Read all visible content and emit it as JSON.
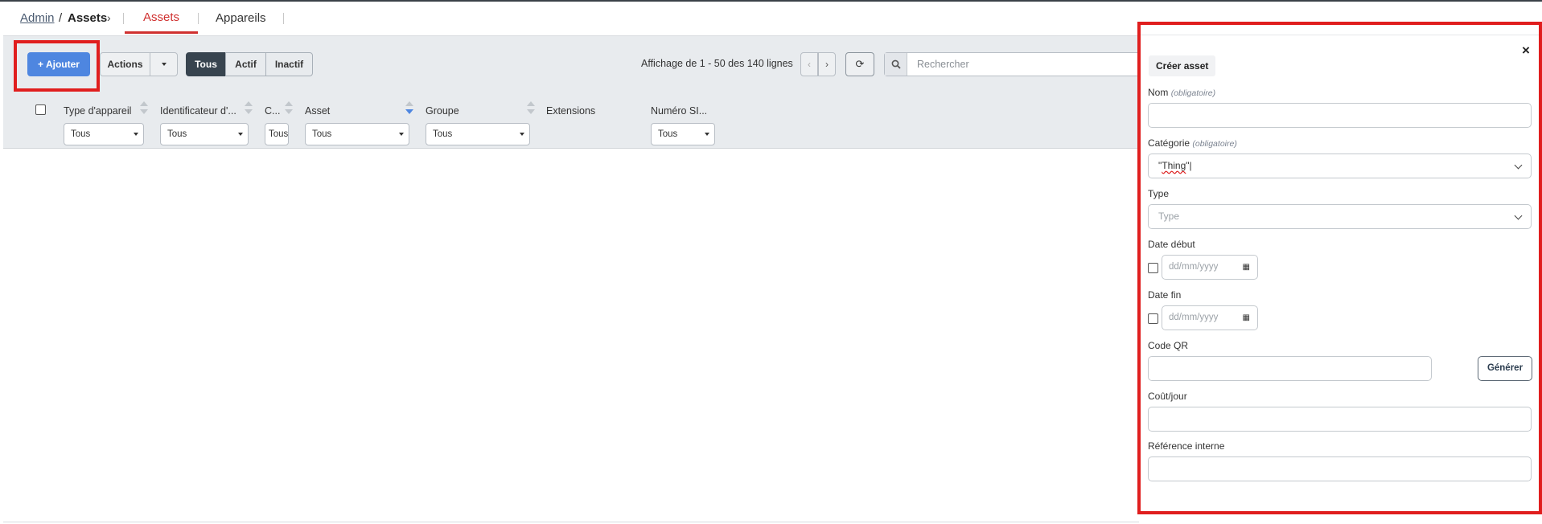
{
  "breadcrumb": {
    "admin": "Admin",
    "separator": "/",
    "current": "Assets",
    "chevron": "›"
  },
  "tabs": [
    {
      "label": "Assets",
      "active": true
    },
    {
      "label": "Appareils",
      "active": false
    }
  ],
  "toolbar": {
    "add_label": "+ Ajouter",
    "actions_label": "Actions",
    "filters": [
      "Tous",
      "Actif",
      "Inactif"
    ],
    "pagination_text": "Affichage de 1 - 50 des 140 lignes",
    "prev_icon": "‹",
    "next_icon": "›",
    "refresh_icon": "⟳",
    "search_icon": "⚲",
    "search_placeholder": "Rechercher"
  },
  "columns": [
    {
      "label": "Type d'appareil",
      "filter": "Tous"
    },
    {
      "label": "Identificateur d'...",
      "filter": "Tous"
    },
    {
      "label": "C...",
      "filter": "Tous"
    },
    {
      "label": "Asset",
      "filter": "Tous"
    },
    {
      "label": "Groupe",
      "filter": "Tous"
    },
    {
      "label": "Extensions",
      "filter": ""
    },
    {
      "label": "Numéro SI...",
      "filter": "Tous"
    }
  ],
  "panel": {
    "close_icon": "×",
    "title": "Créer asset",
    "name_label": "Nom",
    "required_text": "(obligatoire)",
    "category_label": "Catégorie",
    "category_value_pre": "\"",
    "category_value_word": "Thing",
    "category_value_post": "\"|",
    "type_label": "Type",
    "type_placeholder": "Type",
    "start_date_label": "Date début",
    "end_date_label": "Date fin",
    "date_placeholder": "dd/mm/yyyy",
    "calendar_icon": "▦",
    "qr_label": "Code QR",
    "generate_label": "Générer",
    "cost_label": "Coût/jour",
    "internal_ref_label": "Référence interne"
  },
  "colors": {
    "accent": "#d0302f",
    "primary": "#4e86e0",
    "dark_toggle": "#38444f",
    "highlight": "#e01e1e"
  }
}
